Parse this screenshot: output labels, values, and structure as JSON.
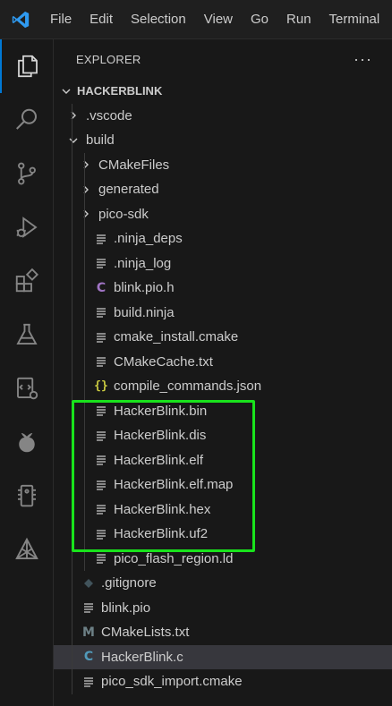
{
  "menu": [
    "File",
    "Edit",
    "Selection",
    "View",
    "Go",
    "Run",
    "Terminal"
  ],
  "explorer": {
    "title": "EXPLORER",
    "more": "···",
    "root": "HACKERBLINK"
  },
  "tree": [
    {
      "label": ".vscode",
      "kind": "folder",
      "expanded": false,
      "depth": 1
    },
    {
      "label": "build",
      "kind": "folder",
      "expanded": true,
      "depth": 1
    },
    {
      "label": "CMakeFiles",
      "kind": "folder",
      "expanded": false,
      "depth": 2
    },
    {
      "label": "generated",
      "kind": "folder",
      "expanded": false,
      "depth": 2
    },
    {
      "label": "pico-sdk",
      "kind": "folder",
      "expanded": false,
      "depth": 2
    },
    {
      "label": ".ninja_deps",
      "kind": "lines",
      "depth": 2
    },
    {
      "label": ".ninja_log",
      "kind": "lines",
      "depth": 2
    },
    {
      "label": "blink.pio.h",
      "kind": "c-header",
      "depth": 2
    },
    {
      "label": "build.ninja",
      "kind": "lines",
      "depth": 2
    },
    {
      "label": "cmake_install.cmake",
      "kind": "lines",
      "depth": 2
    },
    {
      "label": "CMakeCache.txt",
      "kind": "lines",
      "depth": 2
    },
    {
      "label": "compile_commands.json",
      "kind": "json",
      "depth": 2
    },
    {
      "label": "HackerBlink.bin",
      "kind": "lines",
      "depth": 2
    },
    {
      "label": "HackerBlink.dis",
      "kind": "lines",
      "depth": 2
    },
    {
      "label": "HackerBlink.elf",
      "kind": "lines",
      "depth": 2
    },
    {
      "label": "HackerBlink.elf.map",
      "kind": "lines",
      "depth": 2
    },
    {
      "label": "HackerBlink.hex",
      "kind": "lines",
      "depth": 2
    },
    {
      "label": "HackerBlink.uf2",
      "kind": "lines",
      "depth": 2
    },
    {
      "label": "pico_flash_region.ld",
      "kind": "lines",
      "depth": 2
    },
    {
      "label": ".gitignore",
      "kind": "git",
      "depth": 1
    },
    {
      "label": "blink.pio",
      "kind": "lines",
      "depth": 1
    },
    {
      "label": "CMakeLists.txt",
      "kind": "cmake",
      "depth": 1
    },
    {
      "label": "HackerBlink.c",
      "kind": "c-source",
      "depth": 1,
      "selected": true
    },
    {
      "label": "pico_sdk_import.cmake",
      "kind": "lines",
      "depth": 1
    }
  ],
  "colors": {
    "accent": "#0078d4",
    "highlight_box": "#19e31c",
    "c_header": "#a074c4",
    "c_source": "#519aba",
    "json": "#cbcb41",
    "git": "#41535b",
    "cmake": "#6d8086"
  }
}
